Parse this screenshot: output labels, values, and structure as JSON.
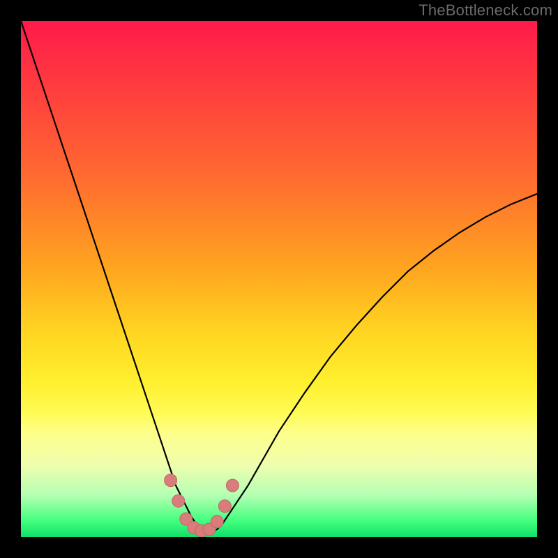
{
  "watermark": "TheBottleneck.com",
  "colors": {
    "frame": "#000000",
    "curve_stroke": "#000000",
    "marker_fill": "#d97c7c",
    "marker_stroke": "#c06868"
  },
  "chart_data": {
    "type": "line",
    "title": "",
    "xlabel": "",
    "ylabel": "",
    "xlim": [
      0,
      100
    ],
    "ylim": [
      0,
      100
    ],
    "grid": false,
    "legend": false,
    "series": [
      {
        "name": "bottleneck-curve",
        "x": [
          0,
          2,
          4,
          6,
          8,
          10,
          12,
          14,
          16,
          18,
          20,
          22,
          24,
          26,
          28,
          30,
          31,
          32,
          33,
          34,
          35,
          36,
          37,
          38,
          39,
          40,
          42,
          44,
          46,
          48,
          50,
          55,
          60,
          65,
          70,
          75,
          80,
          85,
          90,
          95,
          100
        ],
        "y": [
          100,
          94,
          88,
          82,
          76,
          70,
          64,
          58,
          52,
          46,
          40,
          34,
          28,
          22,
          16,
          10,
          8,
          6,
          4,
          2.5,
          1.5,
          1,
          1,
          1.5,
          2.5,
          4,
          7,
          10,
          13.5,
          17,
          20.5,
          28,
          35,
          41,
          46.5,
          51.5,
          55.5,
          59,
          62,
          64.5,
          66.5
        ]
      }
    ],
    "markers": {
      "name": "highlighted-points",
      "x": [
        29,
        30.5,
        32,
        33.5,
        35,
        36.5,
        38,
        39.5,
        41
      ],
      "y": [
        11,
        7,
        3.5,
        1.8,
        1.2,
        1.5,
        3,
        6,
        10
      ]
    },
    "annotations": []
  }
}
